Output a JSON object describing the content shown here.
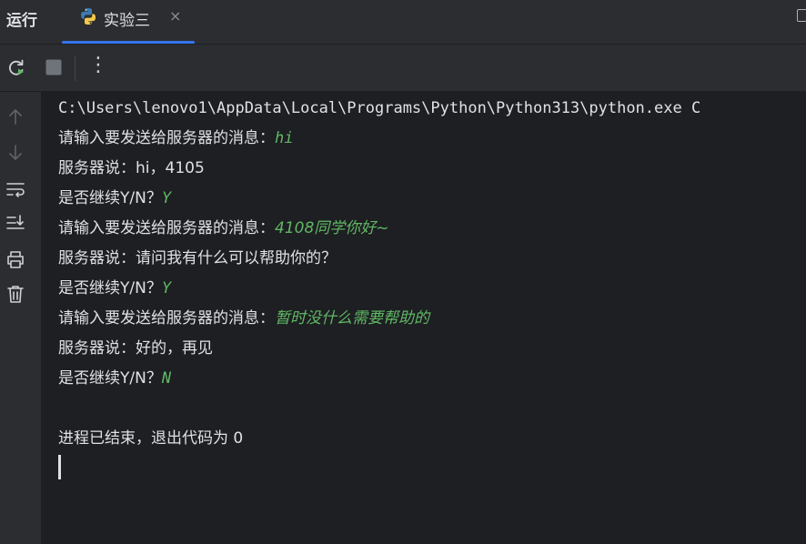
{
  "tabbar": {
    "run_title": "运行",
    "tab_label": "实验三",
    "tab_close": "×"
  },
  "toolbar": {
    "rerun_icon": "rerun-icon",
    "stop_icon": "stop-icon",
    "more_icon": "more-vertical-icon",
    "more_glyph": "⋮"
  },
  "sidebar": {
    "icons": [
      "arrow-up-icon",
      "arrow-down-icon",
      "soft-wrap-icon",
      "scroll-to-end-icon",
      "print-icon",
      "trash-icon"
    ]
  },
  "console": {
    "line0": "C:\\Users\\lenovo1\\AppData\\Local\\Programs\\Python\\Python313\\python.exe C",
    "line1_prompt": "请输入要发送给服务器的消息：",
    "line1_input": "hi",
    "line2": "服务器说：hi，4105",
    "line3_prompt": "是否继续Y/N？",
    "line3_input": "Y",
    "line4_prompt": "请输入要发送给服务器的消息：",
    "line4_input": "4108同学你好~",
    "line5": "服务器说：请问我有什么可以帮助你的？",
    "line6_prompt": "是否继续Y/N？",
    "line6_input": "Y",
    "line7_prompt": "请输入要发送给服务器的消息：",
    "line7_input": "暂时没什么需要帮助的",
    "line8": "服务器说：好的，再见",
    "line9_prompt": "是否继续Y/N？",
    "line9_input": "N",
    "line10": "进程已结束，退出代码为 0"
  },
  "colors": {
    "background": "#1e1f22",
    "panel": "#2b2d30",
    "text": "#dfe1e5",
    "user_input": "#5fb865",
    "accent": "#3574f0"
  }
}
